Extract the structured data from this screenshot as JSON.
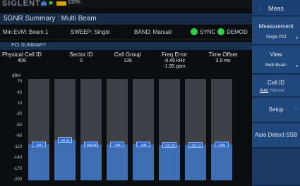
{
  "topbar": {
    "brand": "SIGLENT",
    "battery_text": "100%"
  },
  "title": "5GNR Summary : Multi Beam",
  "status": {
    "min_evm": "Min EVM: Beam 1",
    "sweep": "SWEEP: Single",
    "band": "BAND: Manual",
    "sync": "SYNC",
    "demod": "DEMOD",
    "indicator_color": "#33d04a"
  },
  "pci_summary": {
    "header": "PCI SUMMARY",
    "columns": [
      {
        "label": "Physical Cell ID",
        "value": "408"
      },
      {
        "label": "Sector ID",
        "value": "0"
      },
      {
        "label": "Cell Group",
        "value": "136"
      },
      {
        "label": "Freq Error",
        "value": "-6.46 kHz",
        "value2": "-1.90 ppm"
      },
      {
        "label": "Time Offset",
        "value": "3.9 ms"
      }
    ]
  },
  "chart_data": {
    "type": "bar",
    "ylabel": "dBm",
    "yticks": [
      70,
      40,
      10,
      -20,
      -50,
      -80,
      -110,
      -140,
      -170,
      -200
    ],
    "ylim": [
      -200,
      80
    ],
    "values": [
      -100,
      -89.26,
      -100.16,
      -100,
      -100,
      -103.38,
      -103.12,
      -100
    ],
    "value_labels": [
      "-100",
      "-89.26",
      "-100.16",
      "-100",
      "-100",
      "-103.38",
      "-103.12",
      "-100"
    ],
    "colors": {
      "fill": "#3e6db2",
      "track": "#3f4146",
      "label_bg": "#2d6bd0"
    }
  },
  "menu": {
    "meas": "Meas",
    "measurement": "Measurement",
    "measurement_value": "Single PCI",
    "view": "View",
    "view_value": "Multi Beam",
    "cell_id": "Cell ID",
    "cell_id_auto": "Auto",
    "cell_id_manual": "Manual",
    "setup": "Setup",
    "auto_detect": "Auto Detect SSB"
  }
}
